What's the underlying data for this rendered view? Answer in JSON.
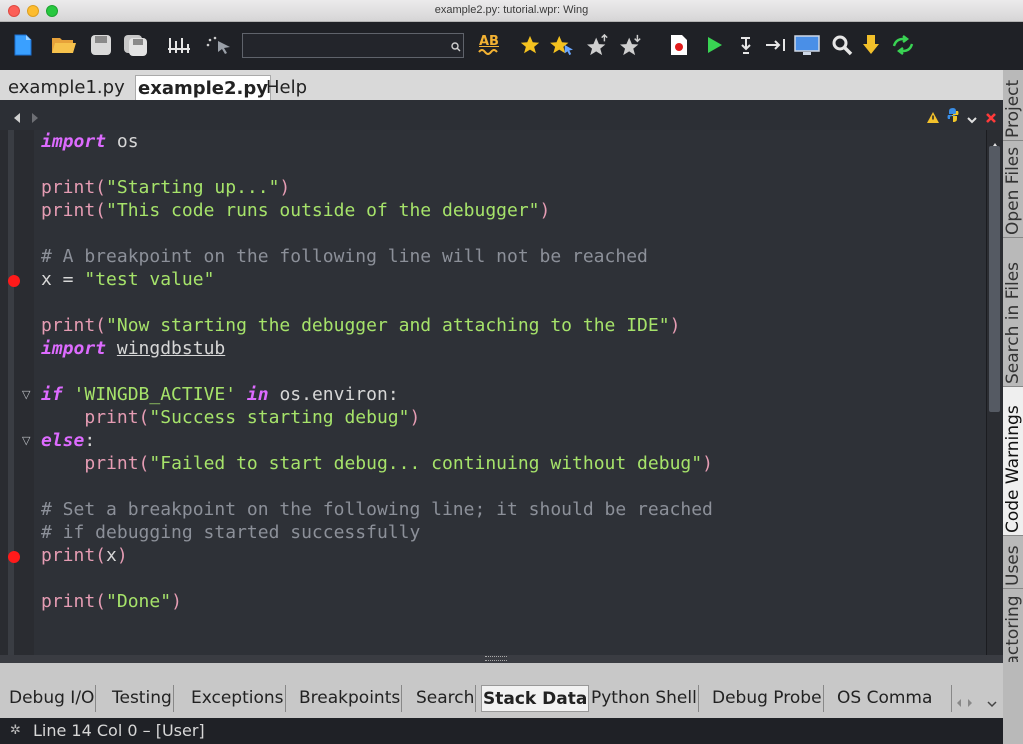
{
  "window": {
    "title": "example2.py: tutorial.wpr: Wing"
  },
  "toolbar": {
    "search": {
      "value": "",
      "placeholder": ""
    },
    "spell_check_label": "AB"
  },
  "editor_tabs": [
    "example1.py",
    "example2.py",
    "Help"
  ],
  "active_editor_tab": "example2.py",
  "code": {
    "line1": {
      "kw": "import",
      "rest": " os"
    },
    "line3": {
      "fn": "print(",
      "str": "\"Starting up...\"",
      "end": ")"
    },
    "line4": {
      "fn": "print(",
      "str": "\"This code runs outside of the debugger\"",
      "end": ")"
    },
    "line6": "# A breakpoint on the following line will not be reached",
    "line7": {
      "a": "x = ",
      "str": "\"test value\""
    },
    "line9": {
      "fn": "print(",
      "str": "\"Now starting the debugger and attaching to the IDE\"",
      "end": ")"
    },
    "line10": {
      "kw": "import",
      "mod": "wingdbstub"
    },
    "line12": {
      "kw": "if",
      "str": " 'WINGDB_ACTIVE' ",
      "kw2": "in",
      "rest": " os.environ:"
    },
    "line13": {
      "indent": "    ",
      "fn": "print(",
      "str": "\"Success starting debug\"",
      "end": ")"
    },
    "line14": {
      "kw": "else",
      "rest": ":"
    },
    "line15": {
      "indent": "    ",
      "fn": "print(",
      "str": "\"Failed to start debug... continuing without debug\"",
      "end": ")"
    },
    "line17": "# Set a breakpoint on the following line; it should be reached",
    "line18": "# if debugging started successfully",
    "line19": {
      "fn": "print(",
      "a": "x",
      "end": ")"
    },
    "line21": {
      "fn": "print(",
      "str": "\"Done\"",
      "end": ")"
    }
  },
  "side_tabs": [
    "Project",
    "Open Files",
    "Search in Files",
    "Code Warnings",
    "Uses",
    "Refactoring"
  ],
  "bottom_tabs": [
    "Debug I/O",
    "Testing",
    "Exceptions",
    "Breakpoints",
    "Search",
    "Stack Data",
    "Python Shell",
    "Debug Probe",
    "OS Comma"
  ],
  "active_bottom_tab": "Stack Data",
  "status": {
    "text": "Line 14 Col 0 – [User]"
  },
  "colors": {
    "keyword": "#dd6bff",
    "string": "#a6e36a",
    "comment": "#8c9099",
    "breakpoint": "#ff1a1a",
    "editor_bg": "#2e3137"
  }
}
